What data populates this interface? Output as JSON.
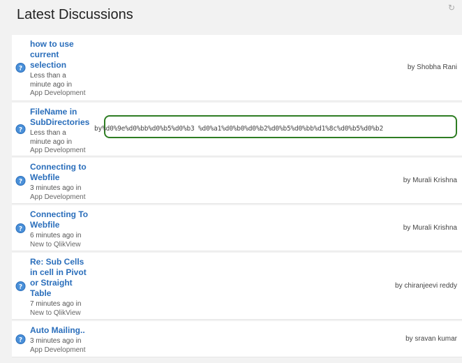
{
  "widget": {
    "title": "Latest Discussions"
  },
  "discussions": [
    {
      "title_lines": [
        "how to use",
        "current",
        "selection"
      ],
      "time_lines": [
        "Less than a",
        "minute ago"
      ],
      "in": "in",
      "place": "App Development",
      "by": "by",
      "author": "Shobha Rani"
    },
    {
      "title_lines": [
        "FileName in",
        "SubDirectories"
      ],
      "time_lines": [
        "Less than a",
        "minute ago"
      ],
      "in": "in",
      "place": "App Development",
      "by": "by",
      "author": "%d0%9e%d0%bb%d0%b5%d0%b3 %d0%a1%d0%b0%d0%b2%d0%b5%d0%bb%d1%8c%d0%b5%d0%b2"
    },
    {
      "title_lines": [
        "Connecting to",
        "Webfile"
      ],
      "time_lines": [
        "3 minutes ago"
      ],
      "in": "in",
      "place": "App Development",
      "by": "by",
      "author": "Murali Krishna"
    },
    {
      "title_lines": [
        "Connecting To",
        "Webfile"
      ],
      "time_lines": [
        "6 minutes ago"
      ],
      "in": "in",
      "place": "New to QlikView",
      "by": "by",
      "author": "Murali Krishna"
    },
    {
      "title_lines": [
        "Re: Sub Cells",
        "in cell in Pivot",
        "or Straight",
        "Table"
      ],
      "time_lines": [
        "7 minutes ago"
      ],
      "in": "in",
      "place": "New to QlikView",
      "by": "by",
      "author": "chiranjeevi reddy"
    },
    {
      "title_lines": [
        "Auto Mailing.."
      ],
      "time_lines": [
        "3 minutes ago"
      ],
      "in": "in",
      "place": "App Development",
      "by": "by",
      "author": "sravan kumar"
    }
  ]
}
